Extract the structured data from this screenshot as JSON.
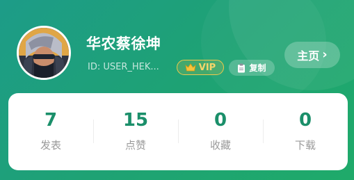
{
  "profile": {
    "name": "华农蔡徐坤",
    "user_id": "ID: USER_HEK...",
    "vip_label": "VIP",
    "copy_label": "复制",
    "home_label": "主页",
    "avatar_icon": "anime-character-avatar"
  },
  "stats": [
    {
      "value": "7",
      "label": "发表"
    },
    {
      "value": "15",
      "label": "点赞"
    },
    {
      "value": "0",
      "label": "收藏"
    },
    {
      "value": "0",
      "label": "下载"
    }
  ],
  "colors": {
    "header_gradient_start": "#1d9c88",
    "header_gradient_end": "#1faa6a",
    "stat_value": "#1b8f6a",
    "vip_gold": "#f1c94b"
  },
  "icons": {
    "vip": "crown-icon",
    "copy": "clipboard-icon",
    "home": "chevron-right-icon"
  }
}
